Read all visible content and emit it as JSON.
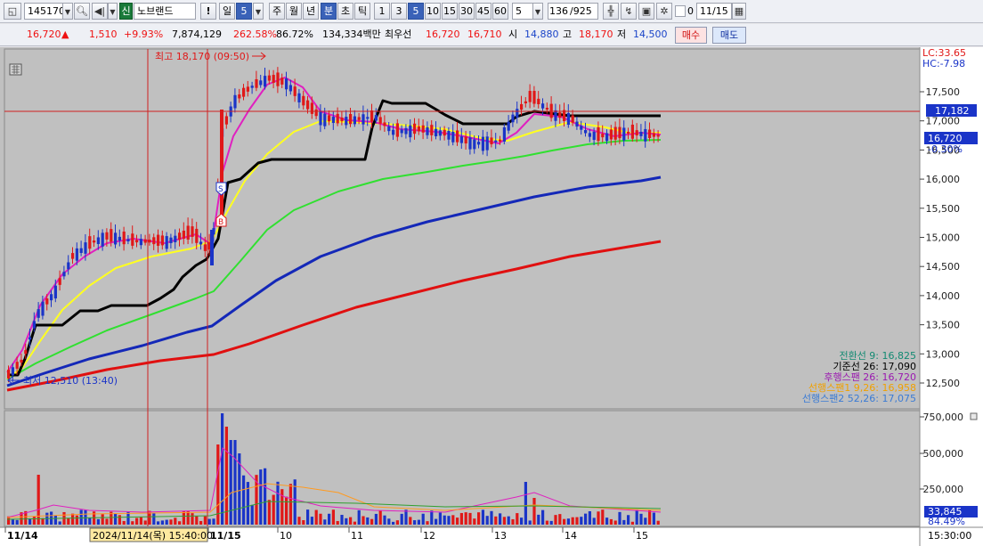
{
  "toolbar": {
    "code": "145170",
    "market_badge": "신",
    "name": "노브랜드",
    "warn": "!",
    "period_day": "일",
    "period_day_n": "5",
    "period_week": "주",
    "period_month": "월",
    "period_year": "년",
    "period_min": "분",
    "period_tick": "초",
    "period_tk": "틱",
    "intervals": [
      "1",
      "3",
      "5",
      "10",
      "15",
      "30",
      "45",
      "60"
    ],
    "interval_n": "5",
    "count": "136",
    "total": "/925",
    "checkbox_label": "0",
    "date": "11/15",
    "icons": [
      "layout-icon",
      "search-icon",
      "volume-icon",
      "chevron-down-icon",
      "grid-icon",
      "replay-icon",
      "save-icon",
      "settings-icon",
      "calendar-icon"
    ]
  },
  "quote": {
    "price": "16,720",
    "arrow": "▲",
    "change": "1,510",
    "change_pct": "+9.93%",
    "volume": "7,874,129",
    "vol_ratio": "262.58%",
    "strength": "86.72%",
    "amount": "134,334백만",
    "best_label": "최우선",
    "best_ask": "16,720",
    "best_bid": "16,710",
    "open_label": "시",
    "open": "14,880",
    "high_label": "고",
    "high": "18,170",
    "low_label": "저",
    "low": "14,500",
    "buy": "매수",
    "sell": "매도"
  },
  "chart": {
    "high_marker": "최고 18,170 (09:50)",
    "low_marker": "최저 12,510 (13:40)",
    "lc": "LC:33.65",
    "hc": "HC:-7.98",
    "price_axis": [
      "17,500",
      "17,000",
      "16,500",
      "16,000",
      "15,500",
      "15,000",
      "14,500",
      "14,000",
      "13,500",
      "13,000",
      "12,500"
    ],
    "crosshair_price": "17,182",
    "current_price": "16,720",
    "current_pct": "-0.30%",
    "ichimoku": [
      {
        "label": "전환선 9: 16,825",
        "color": "#138a72"
      },
      {
        "label": "기준선 26: 17,090",
        "color": "#000000"
      },
      {
        "label": "후행스팬 26: 16,720",
        "color": "#9a19b0"
      },
      {
        "label": "선행스팬1 9,26: 16,958",
        "color": "#f0a000"
      },
      {
        "label": "선행스팬2 52,26: 17,075",
        "color": "#3a7bd5"
      }
    ],
    "volume_axis": [
      "750,000",
      "500,000",
      "250,000"
    ],
    "volume_current": "33,845",
    "volume_pct": "84.49%",
    "date_labels": [
      "11/14",
      "11/15",
      "10",
      "11",
      "12",
      "13",
      "14",
      "15"
    ],
    "crosshair_date": "2024/11/14(목) 15:40:00",
    "time_label": "15:30:00",
    "colors": {
      "up": "#e01818",
      "down": "#1a34c8",
      "ma5": "#e020c0",
      "ma10": "#ffff20",
      "ma20": "#30e030",
      "ma60": "#1428b8",
      "ma120": "#e01010"
    }
  }
}
